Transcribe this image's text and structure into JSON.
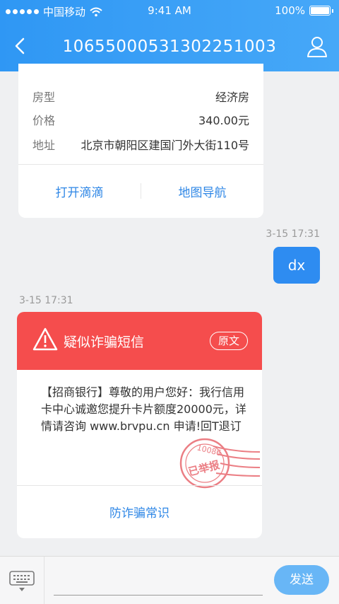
{
  "status_bar": {
    "carrier": "中国移动",
    "time": "9:41 AM",
    "battery": "100%"
  },
  "nav": {
    "title": "10655000531302251003"
  },
  "info_card": {
    "rows": [
      {
        "key": "房型",
        "value": "经济房"
      },
      {
        "key": "价格",
        "value": "340.00元"
      },
      {
        "key": "地址",
        "value": "北京市朝阳区建国门外大街110号"
      }
    ],
    "actions": [
      "打开滴滴",
      "地图导航"
    ]
  },
  "messages": {
    "sent": {
      "timestamp": "3-15  17:31",
      "text": "dx"
    },
    "received_timestamp": "3-15  17:31"
  },
  "fraud_card": {
    "title": "疑似诈骗短信",
    "original_button": "原文",
    "body": "【招商银行】尊敬的用户您好：我行信用卡中心诚邀您提升卡片额度20000元，详情请咨询 www.brvpu.cn 申请!回T退订",
    "stamp_number": "10086",
    "stamp_text": "已举报",
    "tips_link": "防诈骗常识",
    "header_color": "#f54d4d"
  },
  "composer": {
    "send_label": "发送"
  },
  "colors": {
    "accent": "#2e8cf1",
    "link": "#2f87e6"
  }
}
